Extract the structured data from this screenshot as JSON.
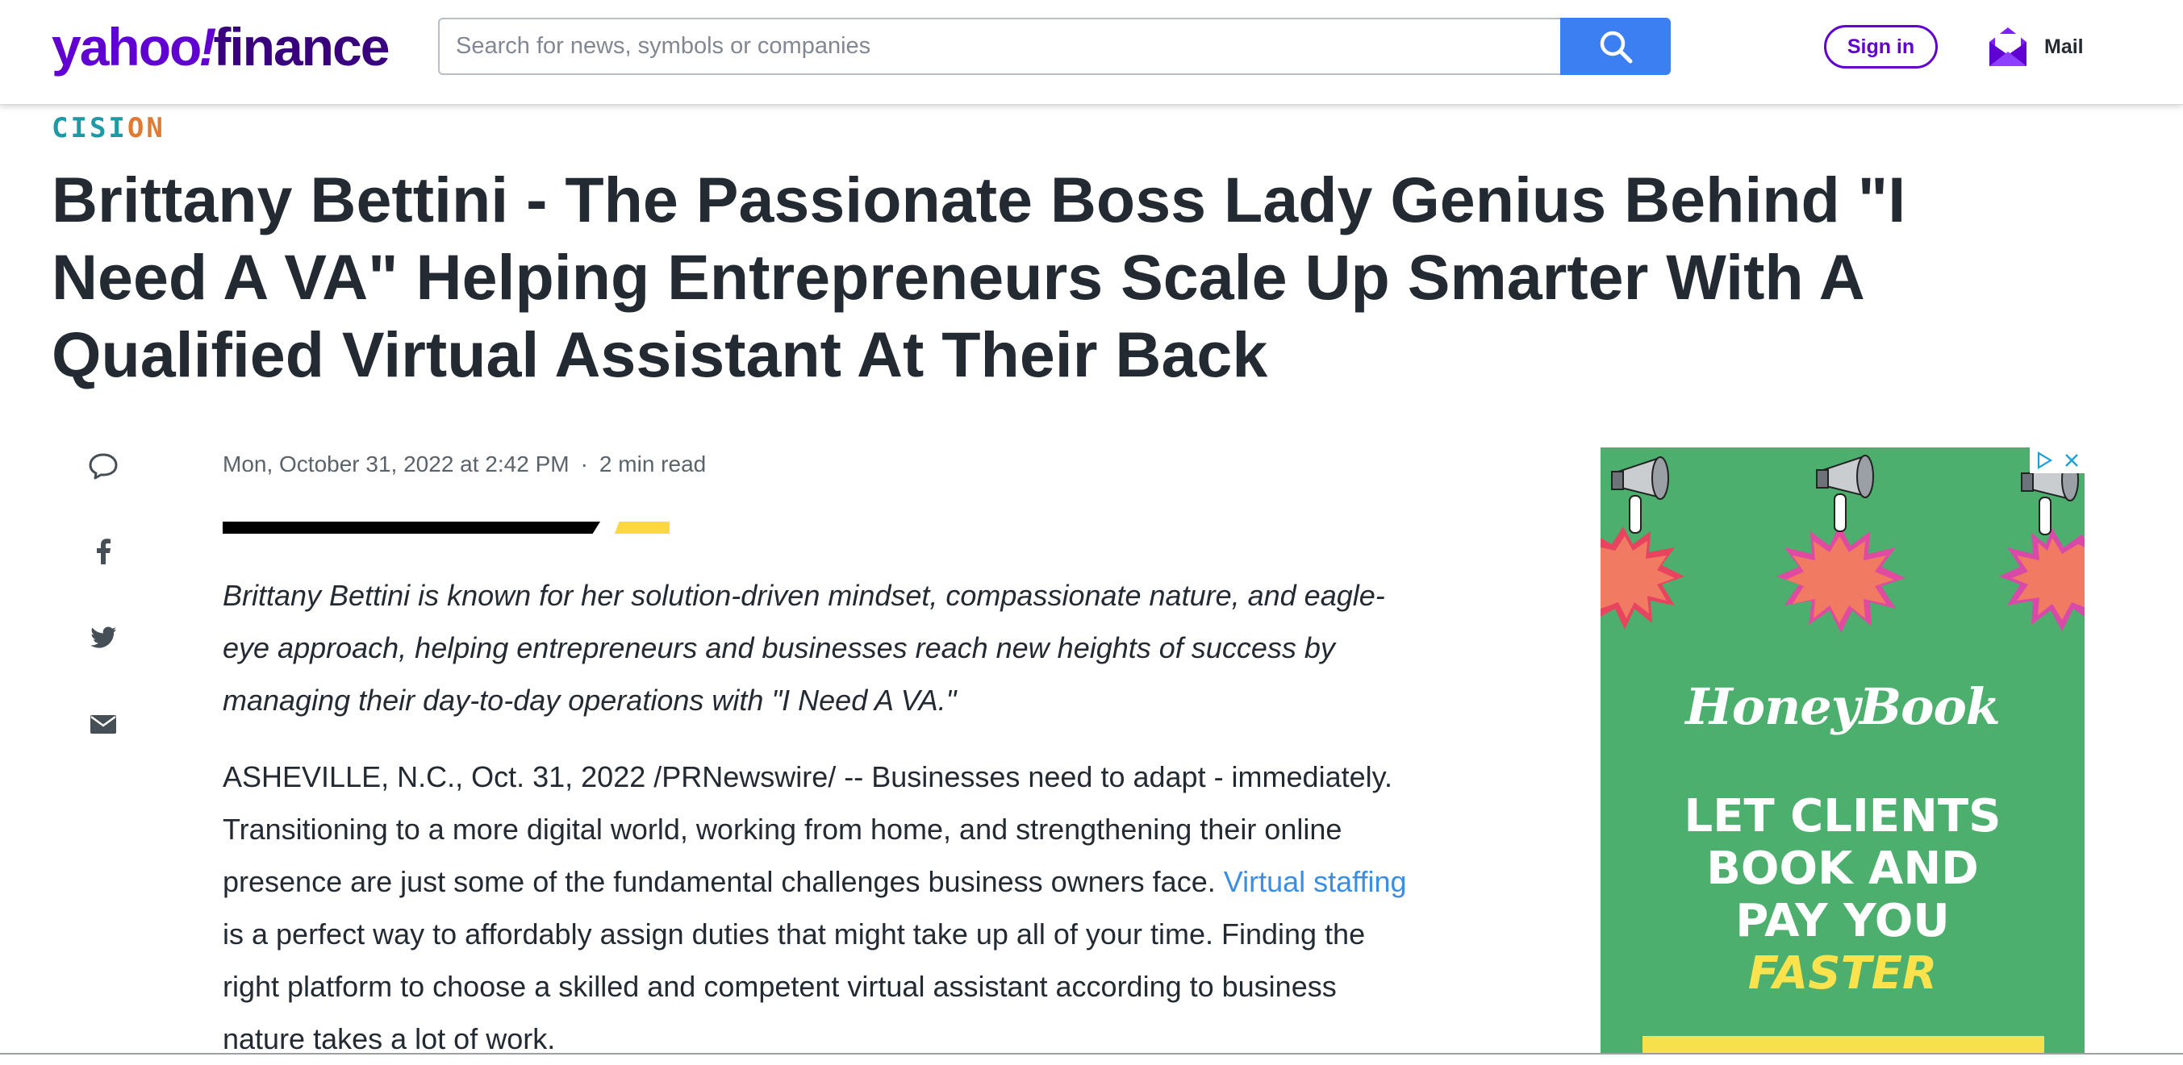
{
  "header": {
    "logo": {
      "part1": "yahoo",
      "bang": "!",
      "part2": "finance"
    },
    "search": {
      "placeholder": "Search for news, symbols or companies",
      "value": ""
    },
    "search_button_icon": "search-icon",
    "signin_label": "Sign in",
    "mail_label": "Mail",
    "mail_icon": "mail-envelope-icon",
    "brand_color": "#6001d2",
    "search_button_color": "#3b7ff3"
  },
  "article": {
    "provider": {
      "part1": "CISI",
      "part2": "ON"
    },
    "headline": "Brittany Bettini - The Passionate Boss Lady Genius Behind \"I Need A VA\" Helping Entrepreneurs Scale Up Smarter With A Qualified Virtual Assistant At Their Back",
    "date": "Mon, October 31, 2022 at 2:42 PM",
    "separator": "·",
    "read_time": "2 min read",
    "summary": "Brittany Bettini is known for her solution-driven mindset, compassionate nature, and eagle-eye approach, helping entrepreneurs and businesses reach new heights of success by managing their day-to-day operations with \"I Need A VA.\"",
    "body": {
      "before_link": "ASHEVILLE, N.C., Oct. 31, 2022 /PRNewswire/ -- Businesses need to adapt - immediately. Transitioning to a more digital world, working from home, and strengthening their online presence are just some of the fundamental challenges business owners face. ",
      "link_text": "Virtual staffing",
      "after_link": " is a perfect way to affordably assign duties that might take up all of your time. Finding the right platform to choose a skilled and competent virtual assistant according to business nature takes a lot of work."
    },
    "link_color": "#3b8ee6"
  },
  "share": [
    {
      "icon": "comment-icon"
    },
    {
      "icon": "facebook-icon"
    },
    {
      "icon": "twitter-icon"
    },
    {
      "icon": "email-icon"
    }
  ],
  "ad": {
    "brand": "HoneyBook",
    "headline_lines": [
      "LET CLIENTS",
      "BOOK AND",
      "PAY YOU"
    ],
    "headline_emphasis": "FASTER",
    "background_color": "#4caf6d",
    "emphasis_color": "#fce34d",
    "choices_icons": [
      "adchoices-icon",
      "close-icon"
    ]
  }
}
